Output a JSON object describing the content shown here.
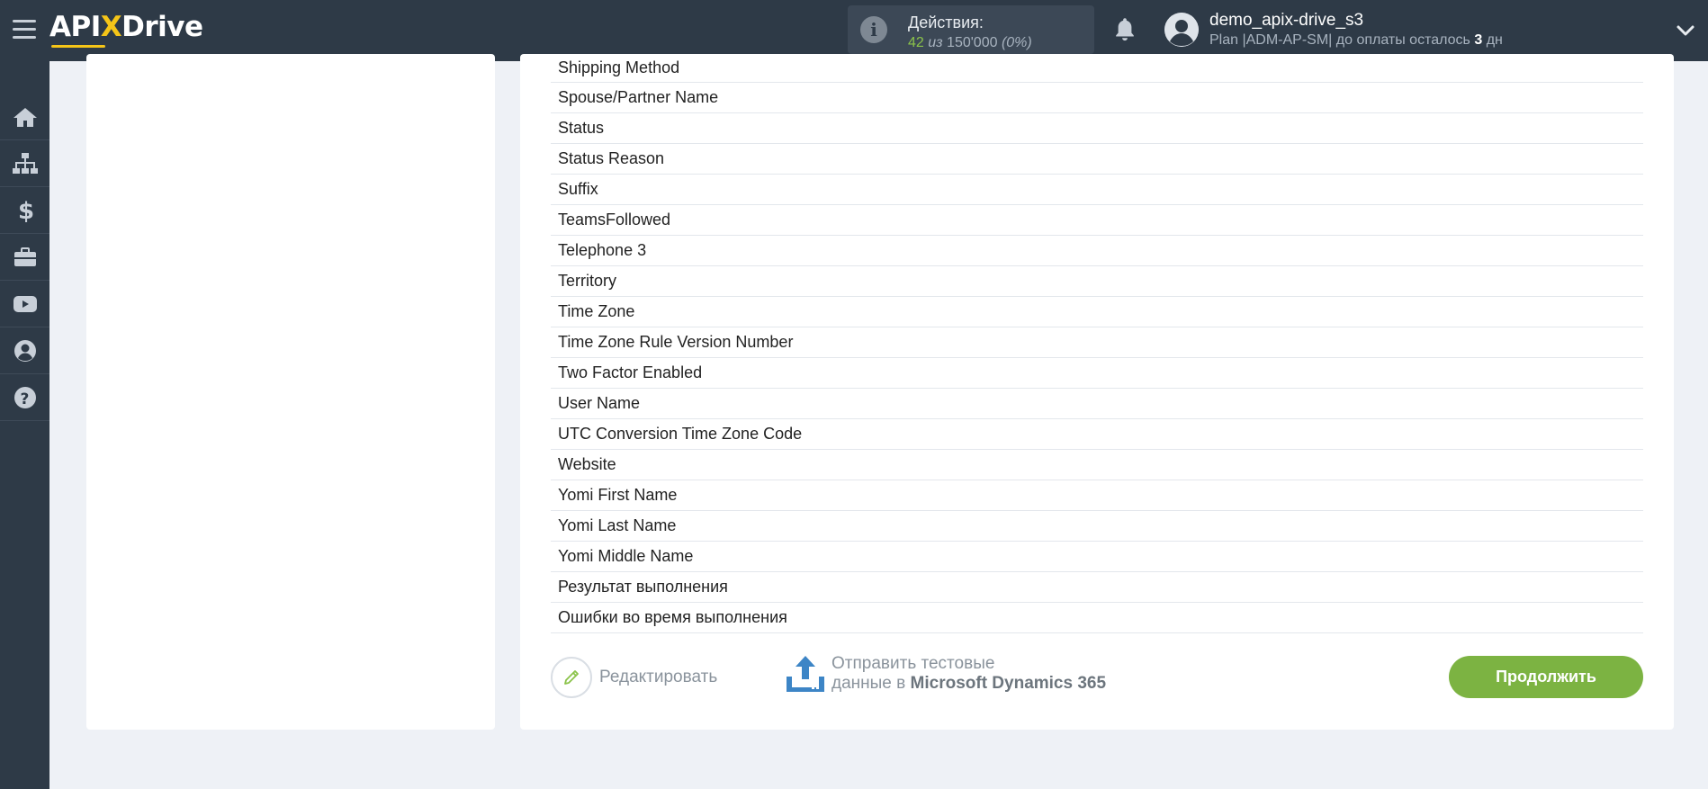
{
  "header": {
    "logo": {
      "part1": "API",
      "x": "X",
      "part2": "Drive"
    },
    "actions": {
      "label": "Действия:",
      "used": "42",
      "of_text": "из",
      "total": "150'000",
      "percent": "(0%)"
    },
    "user": {
      "name": "demo_apix-drive_s3",
      "plan_prefix": "Plan |ADM-AP-SM| до оплаты осталось",
      "days": "3",
      "days_suffix": "дн"
    }
  },
  "sidebar": {
    "items": [
      {
        "icon": "home-icon"
      },
      {
        "icon": "sitemap-icon"
      },
      {
        "icon": "dollar-icon"
      },
      {
        "icon": "briefcase-icon"
      },
      {
        "icon": "youtube-icon"
      },
      {
        "icon": "user-circle-icon"
      },
      {
        "icon": "question-icon"
      }
    ]
  },
  "fields": [
    "Shipping Method",
    "Spouse/Partner Name",
    "Status",
    "Status Reason",
    "Suffix",
    "TeamsFollowed",
    "Telephone 3",
    "Territory",
    "Time Zone",
    "Time Zone Rule Version Number",
    "Two Factor Enabled",
    "User Name",
    "UTC Conversion Time Zone Code",
    "Website",
    "Yomi First Name",
    "Yomi Last Name",
    "Yomi Middle Name",
    "Результат выполнения",
    "Ошибки во время выполнения"
  ],
  "footer": {
    "edit_label": "Редактировать",
    "send_line1": "Отправить тестовые",
    "send_line2_prefix": "данные в",
    "send_target": "Microsoft Dynamics 365",
    "continue_label": "Продолжить"
  },
  "colors": {
    "topbar": "#2e3a47",
    "accent_green": "#7cb342",
    "logo_accent": "#f5c518",
    "upload_blue": "#3d85c6"
  }
}
